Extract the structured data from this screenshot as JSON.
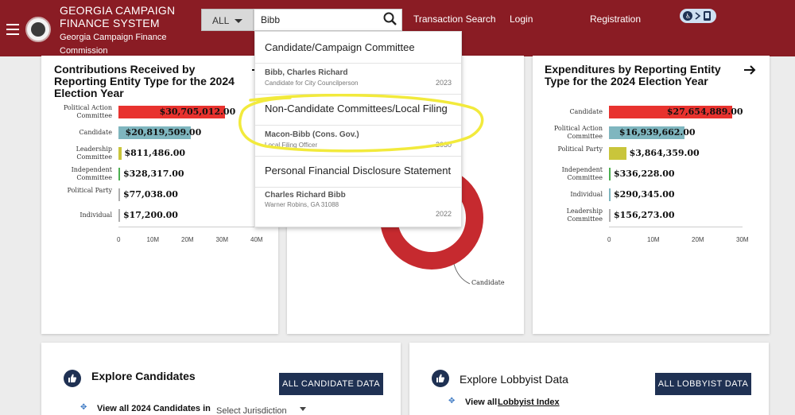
{
  "header": {
    "title": "GEORGIA CAMPAIGN FINANCE SYSTEM",
    "subtitle": "Georgia Campaign Finance Commission",
    "scope": "ALL",
    "search_value": "Bibb",
    "nav": [
      "Transaction Search",
      "Login",
      "Registration"
    ]
  },
  "contrib": {
    "title": "Contributions Received by Reporting Entity Type for the 2024 Election Year",
    "chart_data": {
      "type": "bar",
      "categories": [
        "Political Action Committee",
        "Candidate",
        "Leadership Committee",
        "Independent Committee",
        "Political Party",
        "Individual"
      ],
      "values": [
        30705012,
        20819509,
        811486,
        328317,
        77038,
        17200
      ],
      "value_labels": [
        "$30,705,012.00",
        "$20,819,509.00",
        "$811,486.00",
        "$328,317.00",
        "$77,038.00",
        "$17,200.00"
      ],
      "colors": [
        "#e8322e",
        "#7fb6bf",
        "#c9c53b",
        "#4caf50",
        "#b0b0b0",
        "#b0b0b0"
      ],
      "xticks": [
        "0",
        "10M",
        "20M",
        "30M",
        "40M"
      ],
      "xlim": [
        0,
        40000000
      ]
    }
  },
  "donut": {
    "label": "Candidate",
    "color": "#c62a2f"
  },
  "expend": {
    "title": "Expenditures by Reporting Entity Type for the 2024 Election Year",
    "chart_data": {
      "type": "bar",
      "categories": [
        "Candidate",
        "Political Action Committee",
        "Political Party",
        "Independent Committee",
        "Individual",
        "Leadership Committee"
      ],
      "values": [
        27654889,
        16939662,
        3864359,
        336228,
        290345,
        156273
      ],
      "value_labels": [
        "$27,654,889.00",
        "$16,939,662.00",
        "$3,864,359.00",
        "$336,228.00",
        "$290,345.00",
        "$156,273.00"
      ],
      "colors": [
        "#e8322e",
        "#7fb6bf",
        "#c9c53b",
        "#4caf50",
        "#7fb6bf",
        "#b0b0b0"
      ],
      "xticks": [
        "0",
        "10M",
        "20M",
        "30M"
      ],
      "xlim": [
        0,
        30000000
      ]
    }
  },
  "dropdown": {
    "sections": [
      {
        "heading": "Candidate/Campaign Committee",
        "items": [
          {
            "name": "Bibb, Charles Richard",
            "sub": "Candidate for City Councilperson",
            "year": "2023"
          }
        ]
      },
      {
        "heading": "Non-Candidate Committees/Local Filing",
        "items": [
          {
            "name": "Macon-Bibb (Cons. Gov.)",
            "sub": "Local Filing Officer",
            "year": "2030"
          }
        ]
      },
      {
        "heading": "Personal Financial Disclosure Statement",
        "items": [
          {
            "name": "Charles Richard Bibb",
            "sub": "Warner Robins, GA 31088",
            "year": "2022"
          }
        ]
      }
    ]
  },
  "explore_candidates": {
    "title": "Explore Candidates",
    "button": "ALL CANDIDATE DATA",
    "row_text": "View all 2024 Candidates in",
    "select": "Select Jurisdiction"
  },
  "explore_lobbyist": {
    "title": "Explore Lobbyist Data",
    "button": "ALL LOBBYIST DATA",
    "row_prefix": "View all",
    "row_link": "Lobbyist Index"
  }
}
